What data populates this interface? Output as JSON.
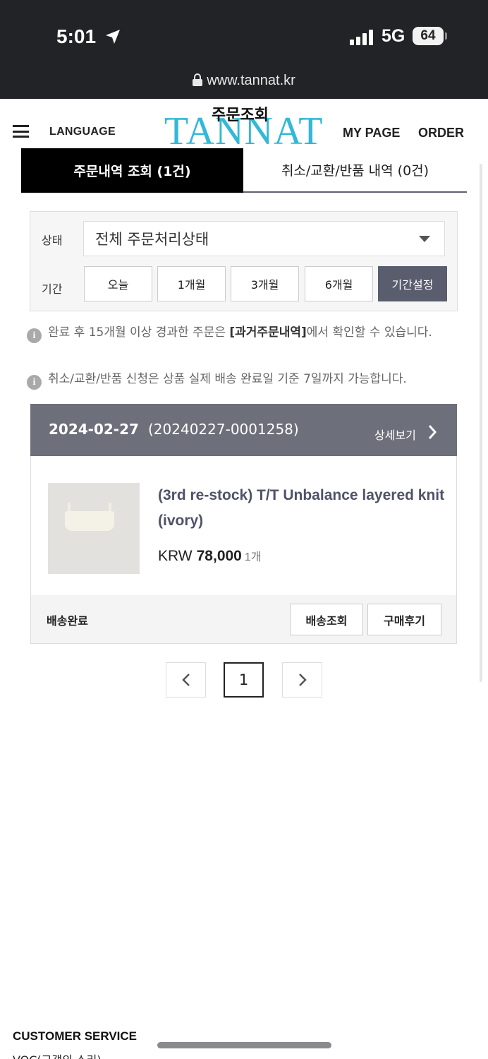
{
  "status_bar": {
    "time": "5:01",
    "network": "5G",
    "battery": "64",
    "url": "www.tannat.kr"
  },
  "header": {
    "language_label": "LANGUAGE",
    "logo_text": "TANNAT",
    "page_title": "주문조회",
    "mypage_label": "MY PAGE",
    "order_label": "ORDER",
    "brand_color": "#33b8d8"
  },
  "tabs": [
    {
      "label": "주문내역 조회  (1건)",
      "active": true
    },
    {
      "label": "취소/교환/반품 내역  (0건)",
      "active": false
    }
  ],
  "filter": {
    "status_label": "상태",
    "status_value": "전체 주문처리상태",
    "period_label": "기간",
    "period_buttons": [
      "오늘",
      "1개월",
      "3개월",
      "6개월",
      "기간설정"
    ]
  },
  "notices": {
    "n1_before": "완료 후 15개월 이상 경과한 주문은 ",
    "n1_bold": "[과거주문내역]",
    "n1_after": "에서 확인할 수 있습니다.",
    "n2": "취소/교환/반품 신청은 상품 실제 배송 완료일 기준 7일까지 가능합니다."
  },
  "order": {
    "date": "2024-02-27",
    "number": "(20240227-0001258)",
    "detail_label": "상세보기",
    "product_name": "(3rd re-stock) T/T Unbalance layered knit (ivory)",
    "currency": "KRW",
    "price": "78,000",
    "quantity": "1개",
    "shipping_status": "배송완료",
    "track_button": "배송조회",
    "review_button": "구매후기"
  },
  "pagination": {
    "current_page": "1"
  },
  "footer": {
    "customer_service": "CUSTOMER SERVICE",
    "voc": "VOC(고객의 소리)"
  }
}
